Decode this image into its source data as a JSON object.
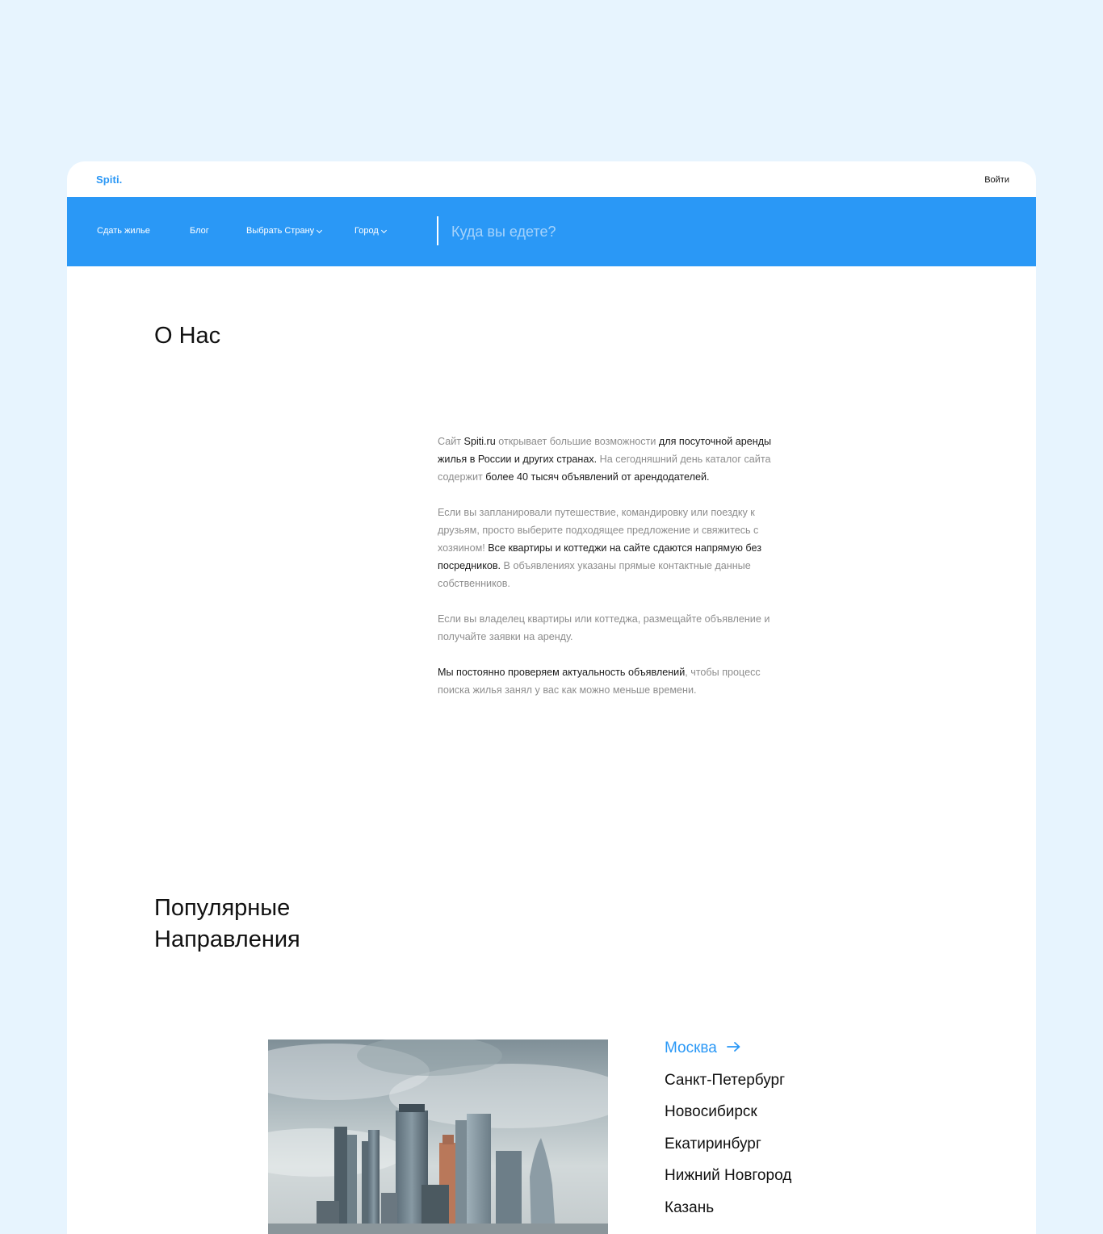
{
  "header": {
    "logo": "Spiti.",
    "login_label": "Войти"
  },
  "nav": {
    "items": [
      {
        "label": "Сдать жилье"
      },
      {
        "label": "Блог"
      },
      {
        "label": "Выбрать Страну",
        "dropdown": true
      },
      {
        "label": "Город",
        "dropdown": true
      }
    ],
    "search_placeholder": "Куда вы едете?"
  },
  "about": {
    "title": "О Нас",
    "p1": [
      {
        "t": "Сайт ",
        "tone": "light"
      },
      {
        "t": "Spiti.ru",
        "tone": "dark"
      },
      {
        "t": " открывает большие возможности ",
        "tone": "light"
      },
      {
        "t": "для посуточной аренды жилья в России и других странах.",
        "tone": "dark"
      },
      {
        "t": " На сегодняшний день каталог сайта содержит ",
        "tone": "light"
      },
      {
        "t": "более 40 тысяч объявлений от арендодателей.",
        "tone": "dark"
      }
    ],
    "p2": [
      {
        "t": "Если вы запланировали путешествие, командировку или поездку к друзьям, просто выберите подходящее предложение и свяжитесь с хозяином!",
        "tone": "light"
      },
      {
        "t": " Все квартиры и коттеджи на сайте сдаются напрямую без посредников.",
        "tone": "dark"
      },
      {
        "t": " В объявлениях указаны прямые контактные данные собственников.",
        "tone": "light"
      }
    ],
    "p3": [
      {
        "t": "Если вы владелец квартиры или коттеджа, размещайте объявление и получайте заявки на аренду.",
        "tone": "light"
      }
    ],
    "p4": [
      {
        "t": "Мы постоянно проверяем актуальность объявлений",
        "tone": "dark"
      },
      {
        "t": ", чтобы процесс поиска жилья занял у вас как можно меньше времени.",
        "tone": "light"
      }
    ]
  },
  "popular": {
    "title_line1": "Популярные",
    "title_line2": "Направления",
    "cities": [
      {
        "name": "Москва",
        "active": true
      },
      {
        "name": "Санкт-Петербург",
        "active": false
      },
      {
        "name": "Новосибирск",
        "active": false
      },
      {
        "name": "Екатиринбург",
        "active": false
      },
      {
        "name": "Нижний Новгород",
        "active": false
      },
      {
        "name": "Казань",
        "active": false
      }
    ]
  },
  "colors": {
    "background": "#e7f4fe",
    "accent": "#2a98f6",
    "text_dark": "#1a1a1a",
    "text_light": "#8d8d8d"
  },
  "icons": [
    "chevron-down-icon",
    "arrow-right-icon"
  ]
}
